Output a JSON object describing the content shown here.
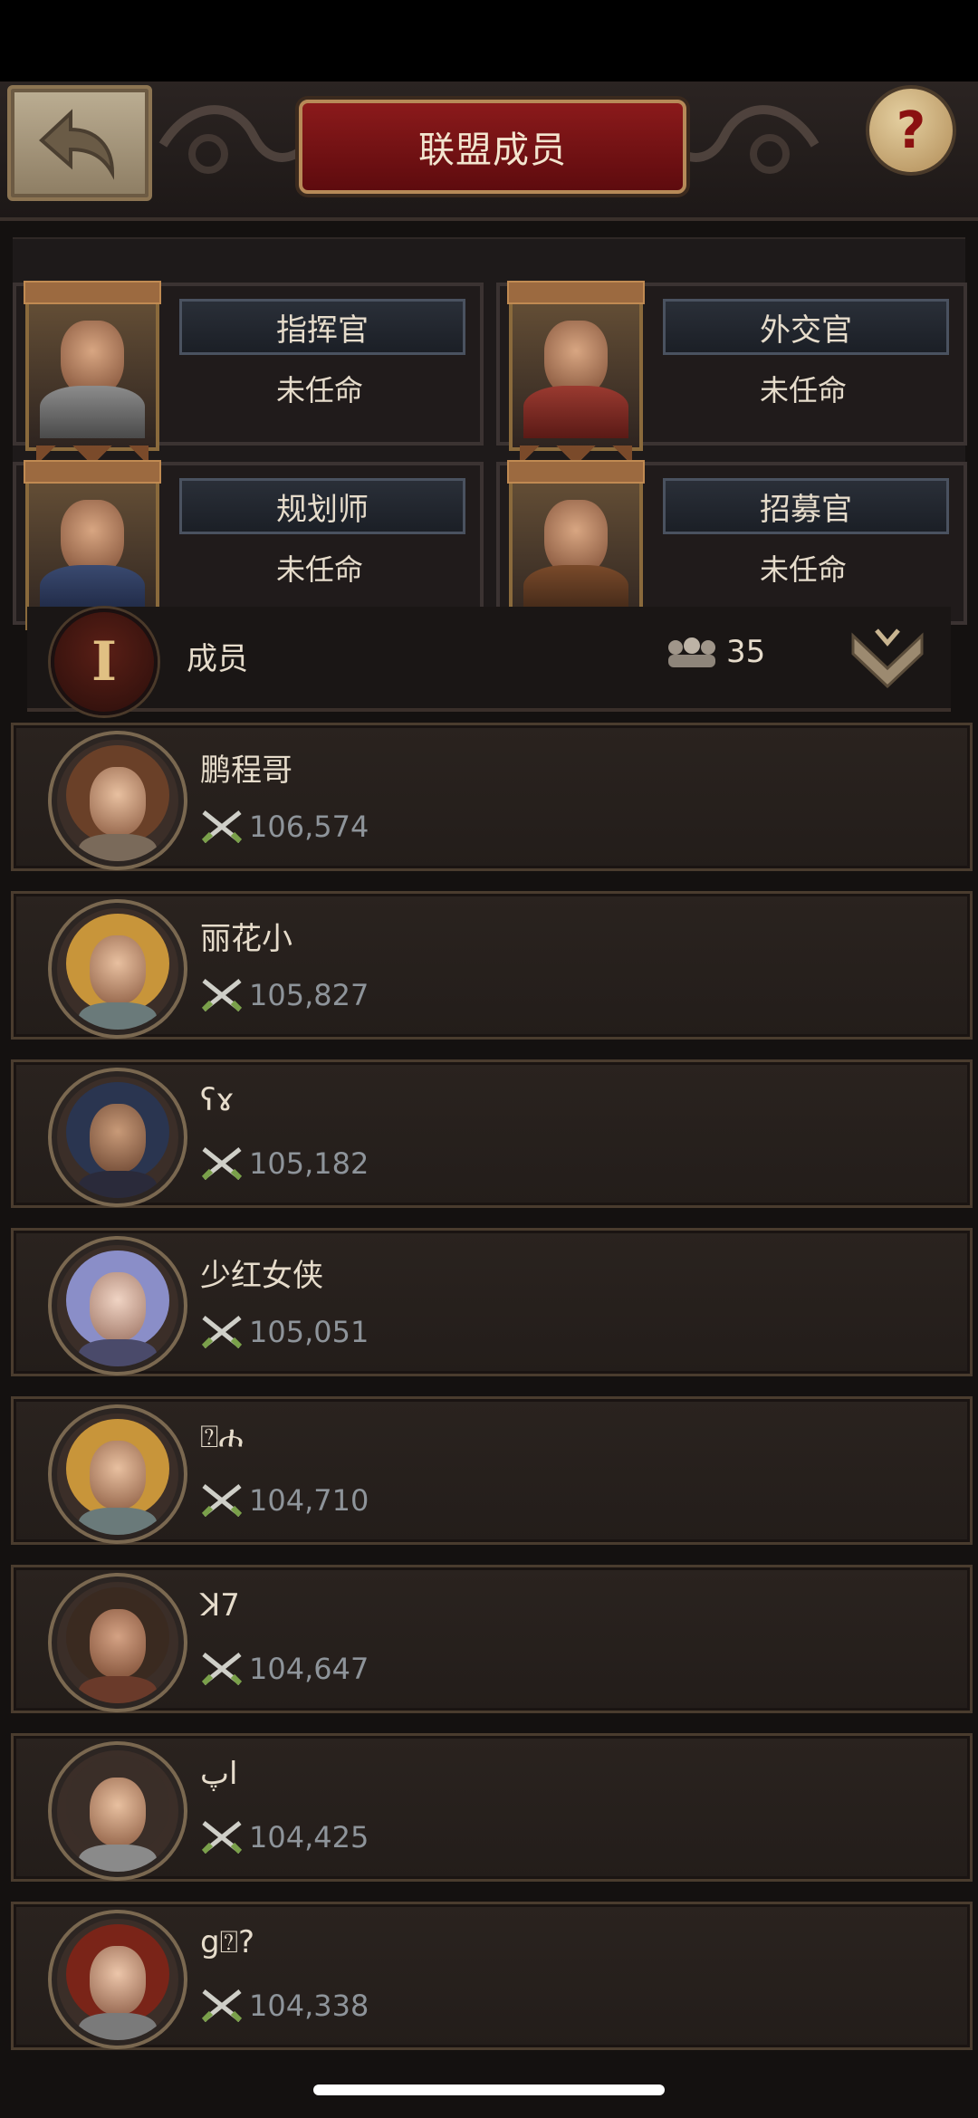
{
  "header": {
    "title": "联盟成员",
    "help_label": "?"
  },
  "officers": [
    {
      "role": "指挥官",
      "status": "未任命"
    },
    {
      "role": "外交官",
      "status": "未任命"
    },
    {
      "role": "规划师",
      "status": "未任命"
    },
    {
      "role": "招募官",
      "status": "未任命"
    }
  ],
  "members_bar": {
    "rank": "I",
    "label": "成员",
    "count": "35"
  },
  "members": [
    {
      "name": "鹏程哥",
      "power": "106,574"
    },
    {
      "name": "丽花小",
      "power": "105,827"
    },
    {
      "name": "ʕɤ",
      "power": "105,182"
    },
    {
      "name": "少红女侠",
      "power": "105,051"
    },
    {
      "name": "⍰ሐ",
      "power": "104,710"
    },
    {
      "name": "ꓘ7",
      "power": "104,647"
    },
    {
      "name": "اپ",
      "power": "104,425"
    },
    {
      "name": "g⍰?",
      "power": "104,338"
    }
  ],
  "colors": {
    "accent": "#8b1a1b",
    "gold": "#b78a58",
    "power_text": "#8e949a"
  }
}
